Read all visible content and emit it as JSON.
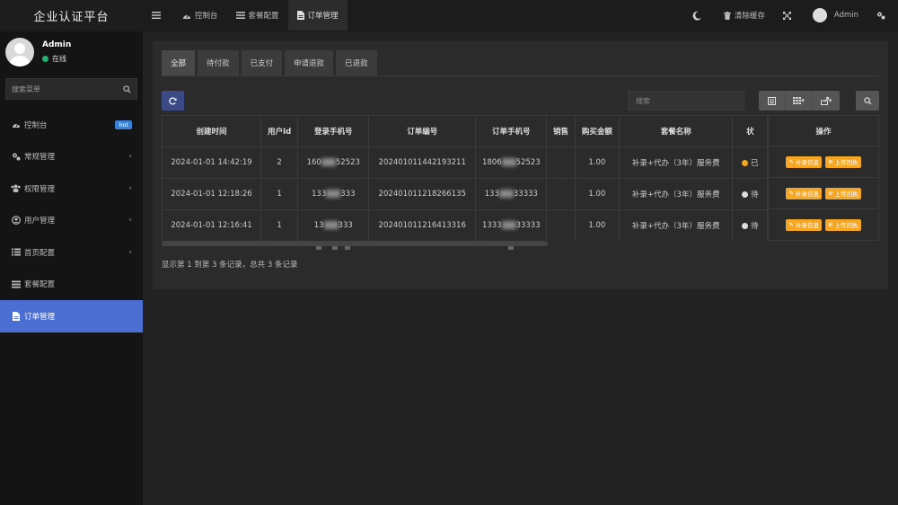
{
  "sidebar": {
    "brand": "企业认证平台",
    "user": {
      "name": "Admin",
      "status": "在线"
    },
    "search": {
      "placeholder": "搜索菜单"
    },
    "items": [
      {
        "label": "控制台",
        "icon": "dashboard-icon",
        "badge": "hot",
        "has_children": false,
        "active": false
      },
      {
        "label": "常规管理",
        "icon": "cogs-icon",
        "has_children": true,
        "active": false
      },
      {
        "label": "权限管理",
        "icon": "group-icon",
        "has_children": true,
        "active": false
      },
      {
        "label": "用户管理",
        "icon": "user-circle-icon",
        "has_children": true,
        "active": false
      },
      {
        "label": "首页配置",
        "icon": "list-icon",
        "has_children": true,
        "active": false
      },
      {
        "label": "套餐配置",
        "icon": "bars-icon",
        "has_children": false,
        "active": false
      },
      {
        "label": "订单管理",
        "icon": "file-icon",
        "has_children": false,
        "active": true
      }
    ]
  },
  "topbar": {
    "menu_toggle_icon": "hamburger-icon",
    "tabs": [
      {
        "label": "控制台",
        "icon": "dashboard-icon",
        "active": false
      },
      {
        "label": "套餐配置",
        "icon": "bars-icon",
        "active": false
      },
      {
        "label": "订单管理",
        "icon": "file-icon",
        "active": true
      }
    ],
    "clear_cache": "清除缓存",
    "user_name": "Admin"
  },
  "filter_tabs": [
    {
      "label": "全部",
      "active": true
    },
    {
      "label": "待付款",
      "active": false
    },
    {
      "label": "已支付",
      "active": false
    },
    {
      "label": "申请退款",
      "active": false
    },
    {
      "label": "已退款",
      "active": false
    }
  ],
  "toolbar": {
    "search_placeholder": "搜索"
  },
  "table": {
    "columns": [
      "创建时间",
      "用户Id",
      "登录手机号",
      "订单编号",
      "订单手机号",
      "销售",
      "购买金额",
      "套餐名称",
      "状",
      "操作"
    ],
    "rows": [
      {
        "created": "2024-01-01 14:42:19",
        "user_id": "2",
        "login_phone_a": "160",
        "login_phone_b": "52523",
        "order_no": "202401011442193211",
        "order_phone_a": "1806",
        "order_phone_b": "52523",
        "sales": "",
        "amount": "1.00",
        "package": "补录+代办（3年）服务费",
        "status_color": "#f5a623",
        "status_text": "已"
      },
      {
        "created": "2024-01-01 12:18:26",
        "user_id": "1",
        "login_phone_a": "133",
        "login_phone_b": "333",
        "order_no": "202401011218266135",
        "order_phone_a": "133",
        "order_phone_b": "33333",
        "sales": "",
        "amount": "1.00",
        "package": "补录+代办（3年）服务费",
        "status_color": "#dddddd",
        "status_text": "待"
      },
      {
        "created": "2024-01-01 12:16:41",
        "user_id": "1",
        "login_phone_a": "13",
        "login_phone_b": "333",
        "order_no": "202401011216413316",
        "order_phone_a": "1333",
        "order_phone_b": "33333",
        "sales": "",
        "amount": "1.00",
        "package": "补录+代办（3年）服务费",
        "status_color": "#dddddd",
        "status_text": "待"
      }
    ],
    "actions": [
      "补录信息",
      "上传回执"
    ]
  },
  "summary": "显示第 1 到第 3 条记录，总共 3 条记录"
}
